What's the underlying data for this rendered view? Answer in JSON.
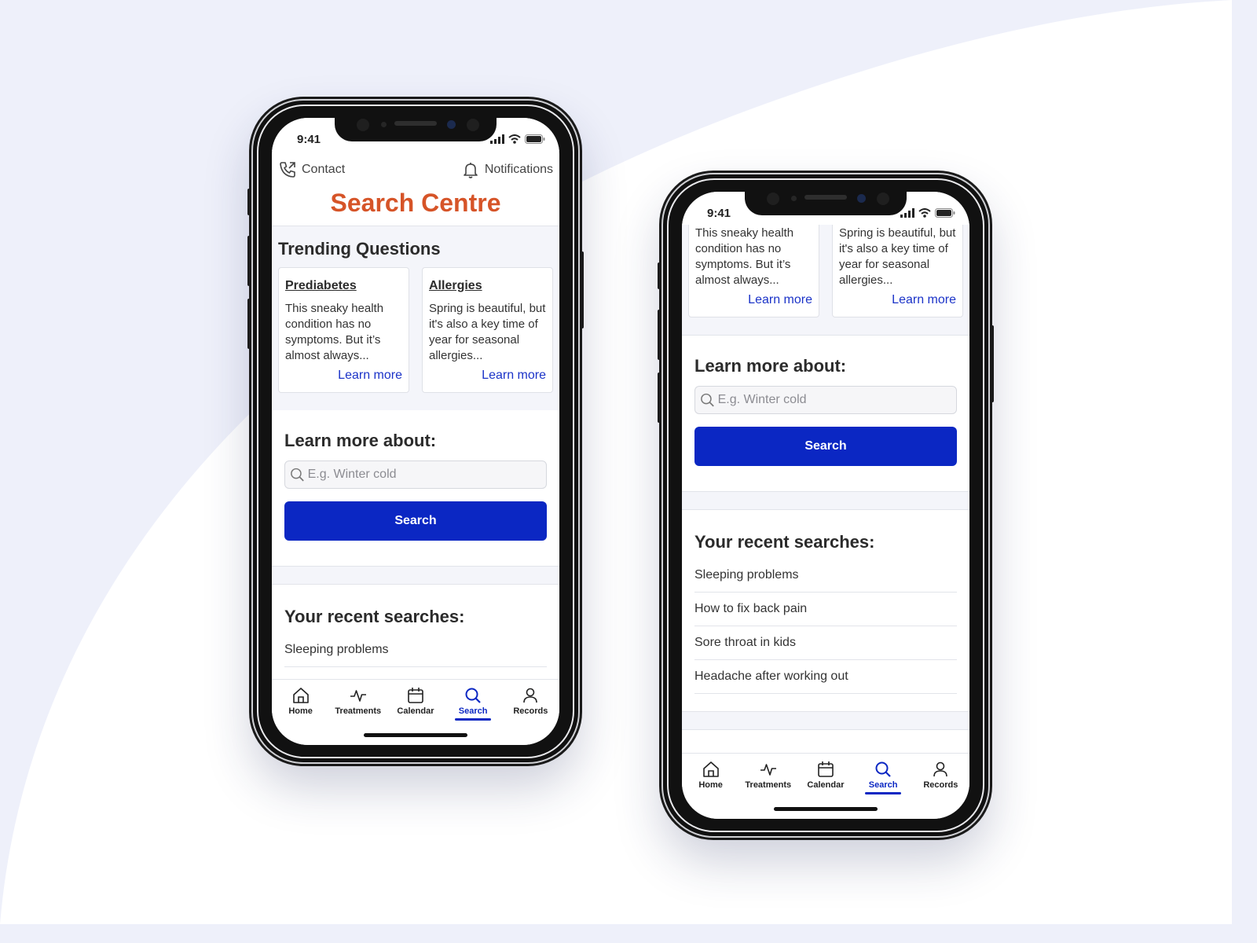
{
  "colors": {
    "title_orange": "#d65428",
    "primary_blue": "#0b27c3",
    "link_blue": "#1b33c8",
    "background": "#eef0fa"
  },
  "status_bar": {
    "time": "9:41"
  },
  "header": {
    "contact_label": "Contact",
    "notifications_label": "Notifications",
    "title": "Search Centre"
  },
  "trending": {
    "heading": "Trending Questions",
    "cards": [
      {
        "title": "Prediabetes",
        "text": "This sneaky health condition has no symptoms. But it’s almost always...",
        "link": "Learn more"
      },
      {
        "title": "Allergies",
        "text": "Spring is beautiful, but it's also a key time of year for seasonal allergies...",
        "link": "Learn more"
      }
    ]
  },
  "learn": {
    "heading": "Learn more about:",
    "placeholder": "E.g. Winter cold",
    "button_label": "Search"
  },
  "recent": {
    "heading": "Your recent searches:",
    "items": [
      "Sleeping problems",
      "How to fix back pain",
      "Sore throat in kids",
      "Headache after working out"
    ]
  },
  "tabs": [
    {
      "label": "Home",
      "icon": "home-icon"
    },
    {
      "label": "Treatments",
      "icon": "pulse-icon"
    },
    {
      "label": "Calendar",
      "icon": "calendar-icon"
    },
    {
      "label": "Search",
      "icon": "search-icon",
      "active": true
    },
    {
      "label": "Records",
      "icon": "person-icon"
    }
  ]
}
